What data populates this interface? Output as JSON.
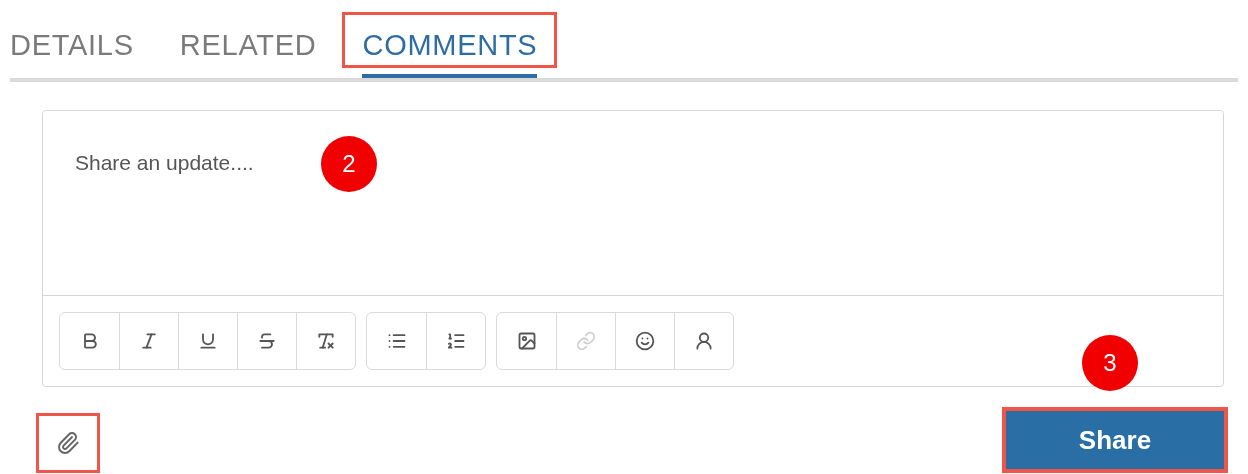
{
  "tabs": [
    {
      "label": "DETAILS",
      "selected": false,
      "highlighted": false
    },
    {
      "label": "RELATED",
      "selected": false,
      "highlighted": false
    },
    {
      "label": "COMMENTS",
      "selected": true,
      "highlighted": true
    }
  ],
  "editor": {
    "placeholder": "Share an update....",
    "callout": "2",
    "toolbar_groups": [
      [
        {
          "disabled": false
        },
        {
          "disabled": false
        },
        {
          "disabled": false
        },
        {
          "disabled": false
        },
        {
          "disabled": false
        }
      ],
      [
        {
          "disabled": false
        },
        {
          "disabled": false
        }
      ],
      [
        {
          "disabled": false
        },
        {
          "disabled": true
        },
        {
          "disabled": false
        },
        {
          "disabled": false
        }
      ]
    ]
  },
  "attach_button": {
    "highlighted": true
  },
  "share_button": {
    "label": "Share",
    "highlighted": true,
    "callout": "3"
  }
}
